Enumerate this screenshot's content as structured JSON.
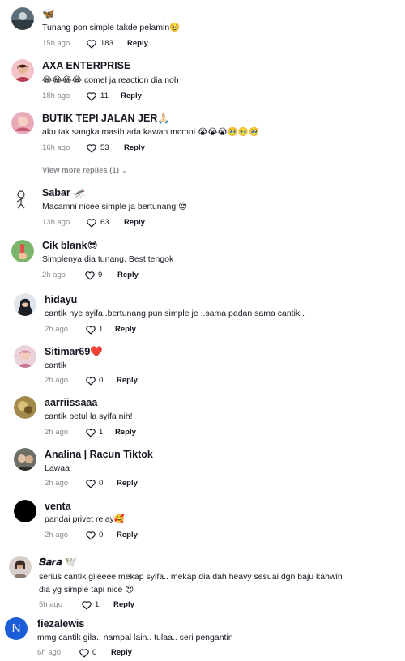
{
  "comments": [
    {
      "username": "🦋",
      "text": "Tunang pon simple takde pelamin🥹",
      "time": "15h ago",
      "likes": "183",
      "reply": "Reply"
    },
    {
      "username": "AXA ENTERPRISE",
      "text": "😂😂😂😂 comel ja reaction dia noh",
      "time": "18h ago",
      "likes": "11",
      "reply": "Reply"
    },
    {
      "username": "BUTIK TEPI JALAN JER🙏🏻",
      "text": "aku tak sangka masih ada kawan mcmni 😭😭😭🥹🥹🥹",
      "time": "16h ago",
      "likes": "53",
      "reply": "Reply"
    },
    {
      "username": "Sabar 🦟",
      "text": "Macamni nicee simple ja bertunang 😍",
      "time": "13h ago",
      "likes": "63",
      "reply": "Reply"
    },
    {
      "username": "Cik blank😎",
      "text": "Simplenya dia tunang. Best tengok",
      "time": "2h ago",
      "likes": "9",
      "reply": "Reply"
    },
    {
      "username": "hidayu",
      "text": "cantik nye syifa..bertunang pun simple je ..sama padan sama cantik..",
      "time": "2h ago",
      "likes": "1",
      "reply": "Reply"
    },
    {
      "username": "Sitimar69❤️",
      "text": "cantik",
      "time": "2h ago",
      "likes": "0",
      "reply": "Reply"
    },
    {
      "username": "aarriissaaa",
      "text": "cantik betul la syifa nih!",
      "time": "2h ago",
      "likes": "1",
      "reply": "Reply"
    },
    {
      "username": "Analina | Racun Tiktok",
      "text": "Lawaa",
      "time": "2h ago",
      "likes": "0",
      "reply": "Reply"
    },
    {
      "username": "venta",
      "text": "pandai privet relay🥰",
      "time": "2h ago",
      "likes": "0",
      "reply": "Reply"
    },
    {
      "username": "𝑺𝒂𝒓𝒂 🕊️",
      "text_lines": [
        "serius cantik gileeee mekap syifa.. mekap dia dah heavy sesuai dgn baju kahwin",
        "dia yg simple tapi nice 😍"
      ],
      "time": "5h ago",
      "likes": "1",
      "reply": "Reply"
    },
    {
      "username": "fiezalewis",
      "text": "mmg cantik gila.. nampal lain.. tulaa.. seri pengantin",
      "time": "6h ago",
      "likes": "0",
      "reply": "Reply",
      "avatar_letter": "N"
    }
  ],
  "view_more": "View more replies (1)",
  "colors": {
    "accent_blue": "#1a5dd6",
    "reply_gray": "#8a8b91",
    "text": "#161823"
  },
  "icons": {
    "like": "heart-outline-icon",
    "expand": "chevron-down-icon"
  }
}
